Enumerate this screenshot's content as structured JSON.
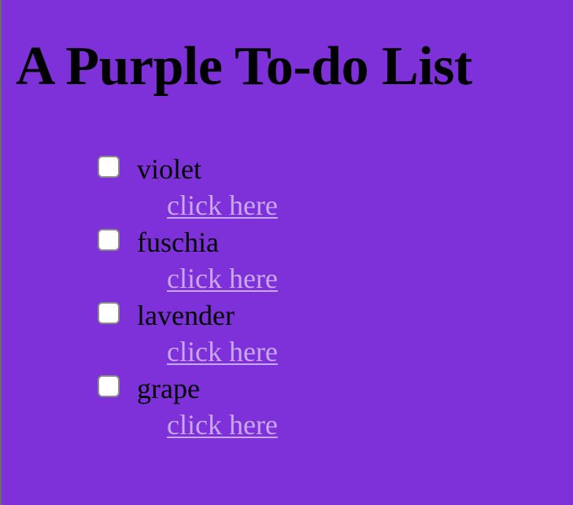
{
  "page": {
    "title": "A Purple To-do List",
    "background_color": "#7e31d9",
    "link_color": "#c8a8f2"
  },
  "todos": [
    {
      "label": "violet",
      "checked": false,
      "link_text": "click here"
    },
    {
      "label": "fuschia",
      "checked": false,
      "link_text": "click here"
    },
    {
      "label": "lavender",
      "checked": false,
      "link_text": "click here"
    },
    {
      "label": "grape",
      "checked": false,
      "link_text": "click here"
    }
  ]
}
